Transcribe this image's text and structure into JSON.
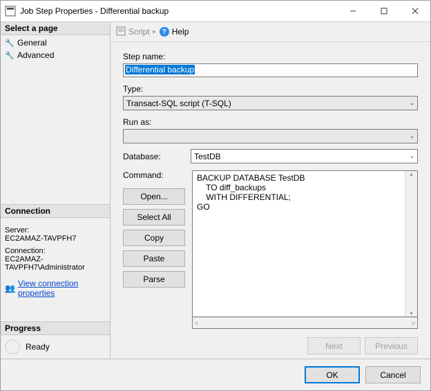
{
  "window": {
    "title": "Job Step Properties - Differential backup"
  },
  "sidebar": {
    "select_page_header": "Select a page",
    "pages": [
      {
        "icon": "wrench-icon",
        "label": "General"
      },
      {
        "icon": "wrench-icon",
        "label": "Advanced"
      }
    ],
    "connection_header": "Connection",
    "server_label": "Server:",
    "server_value": "EC2AMAZ-TAVPFH7",
    "connection_label": "Connection:",
    "connection_value": "EC2AMAZ-TAVPFH7\\Administrator",
    "view_connection_link": "View connection properties",
    "progress_header": "Progress",
    "progress_status": "Ready"
  },
  "toolbar": {
    "script_label": "Script",
    "help_label": "Help"
  },
  "form": {
    "step_name_label": "Step name:",
    "step_name_value": "Differential backup",
    "type_label": "Type:",
    "type_value": "Transact-SQL script (T-SQL)",
    "run_as_label": "Run as:",
    "run_as_value": "",
    "database_label": "Database:",
    "database_value": "TestDB",
    "command_label": "Command:",
    "command_text": "BACKUP DATABASE TestDB\n    TO diff_backups\n    WITH DIFFERENTIAL;\nGO",
    "buttons": {
      "open": "Open...",
      "select_all": "Select All",
      "copy": "Copy",
      "paste": "Paste",
      "parse": "Parse"
    },
    "nav": {
      "next": "Next",
      "previous": "Previous"
    }
  },
  "dialog": {
    "ok": "OK",
    "cancel": "Cancel"
  }
}
